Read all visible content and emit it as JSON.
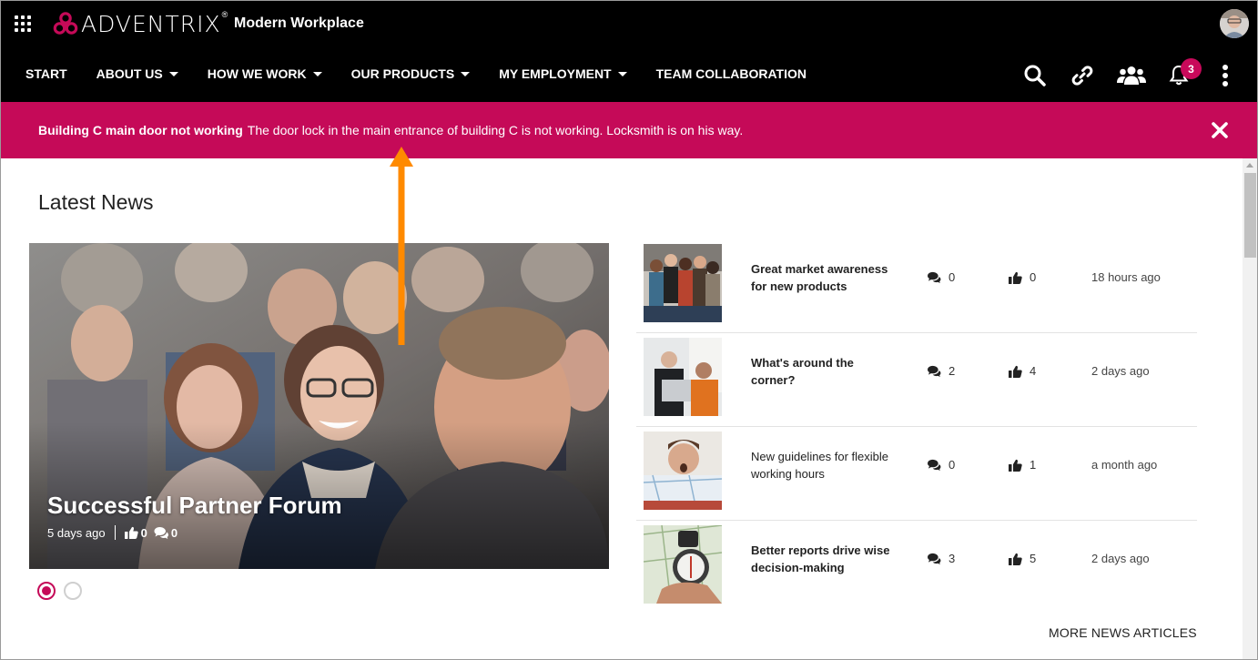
{
  "app": {
    "brand": "ADVENTRIX",
    "brand_mark": "®",
    "site_title": "Modern Workplace"
  },
  "nav": {
    "items": [
      {
        "label": "START",
        "dropdown": false
      },
      {
        "label": "ABOUT US",
        "dropdown": true
      },
      {
        "label": "HOW WE WORK",
        "dropdown": true
      },
      {
        "label": "OUR PRODUCTS",
        "dropdown": true
      },
      {
        "label": "MY EMPLOYMENT",
        "dropdown": true
      },
      {
        "label": "TEAM COLLABORATION",
        "dropdown": false
      }
    ],
    "icons": [
      "search-icon",
      "link-icon",
      "people-icon",
      "bell-icon",
      "more-vertical-icon"
    ],
    "notification_count": "3"
  },
  "alert": {
    "title": "Building C main door not working",
    "message": "The door lock in the main entrance of building C is not working. Locksmith is on his way.",
    "color": "#c50a58"
  },
  "news": {
    "section_title": "Latest News",
    "featured": {
      "title": "Successful Partner Forum",
      "time": "5 days ago",
      "likes": "0",
      "comments": "0"
    },
    "carousel_active_index": 0,
    "carousel_count": 2,
    "items": [
      {
        "title": "Great market awareness for new products",
        "bold": true,
        "comments": "0",
        "likes": "0",
        "time": "18 hours ago"
      },
      {
        "title": "What's around the corner?",
        "bold": true,
        "comments": "2",
        "likes": "4",
        "time": "2 days ago"
      },
      {
        "title": "New guidelines for flexible working hours",
        "bold": false,
        "comments": "0",
        "likes": "1",
        "time": "a month ago"
      },
      {
        "title": "Better reports drive wise decision-making",
        "bold": true,
        "comments": "3",
        "likes": "5",
        "time": "2 days ago"
      }
    ],
    "more_label": "MORE NEWS ARTICLES"
  },
  "colors": {
    "accent": "#c50a58",
    "topbar": "#000000",
    "annotation_arrow": "#ff8a00"
  }
}
